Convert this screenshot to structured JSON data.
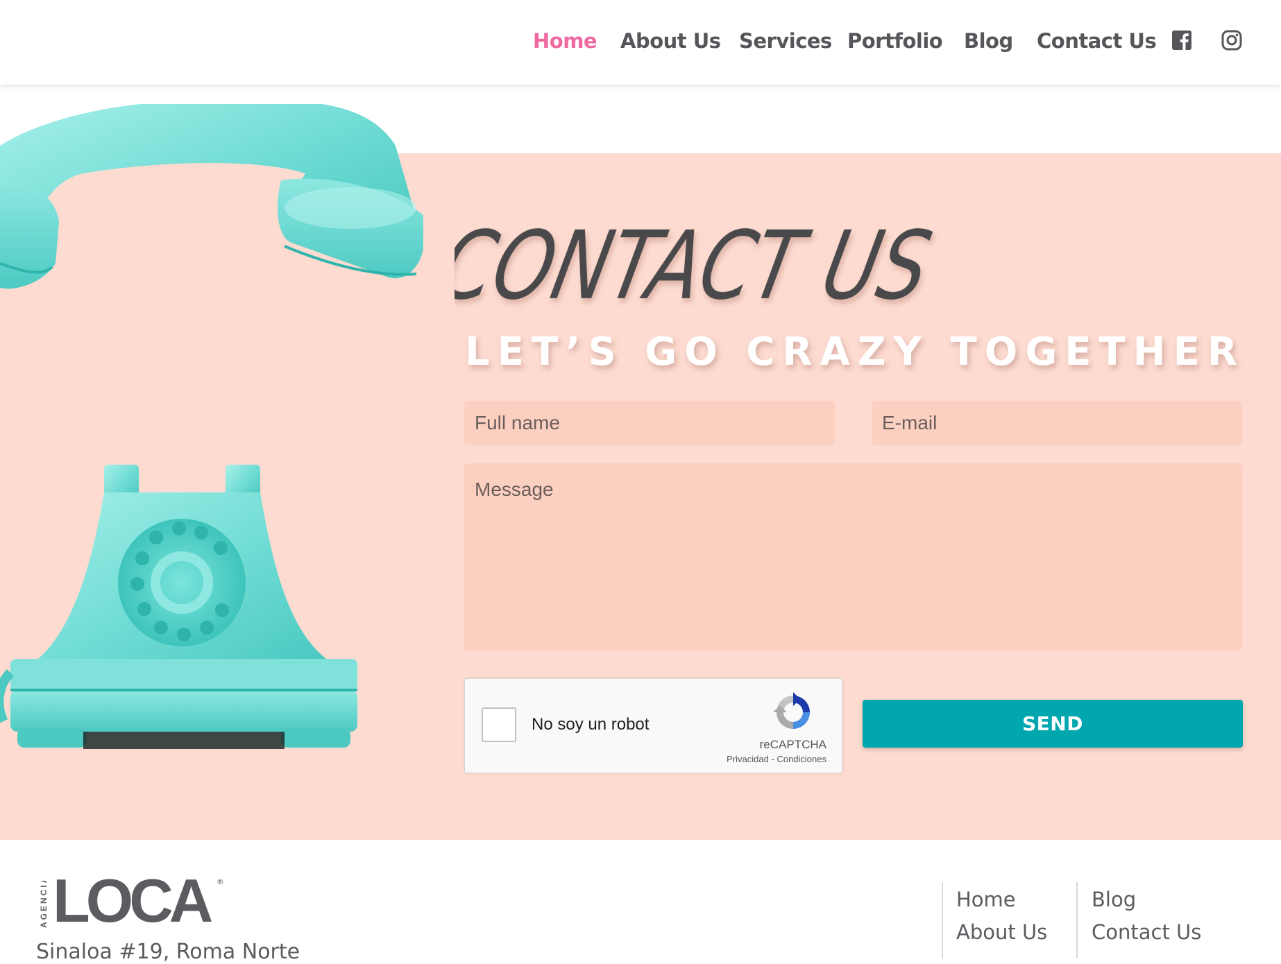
{
  "nav": {
    "items": [
      "Home",
      "About Us",
      "Services",
      "Portfolio",
      "Blog",
      "Contact Us"
    ],
    "active": "Home",
    "active_color": "#f06aa2",
    "social": [
      "facebook-icon",
      "instagram-icon"
    ]
  },
  "hero": {
    "title": "CONTACT US",
    "subtitle": "LET’S GO CRAZY TOGETHER",
    "background_color": "#fddbd0"
  },
  "form": {
    "fullname_placeholder": "Full name",
    "email_placeholder": "E-mail",
    "message_placeholder": "Message",
    "send_label": "SEND",
    "send_color": "#00a7ae"
  },
  "recaptcha": {
    "label": "No soy un robot",
    "brand": "reCAPTCHA",
    "privacy": "Privacidad",
    "separator": "-",
    "terms": "Condiciones"
  },
  "footer": {
    "logo_vertical": "AGENCIA",
    "logo_main": "LOCA",
    "logo_reg": "®",
    "address": "Sinaloa #19, Roma Norte",
    "links_col1": [
      "Home",
      "About Us"
    ],
    "links_col2": [
      "Blog",
      "Contact Us"
    ]
  }
}
